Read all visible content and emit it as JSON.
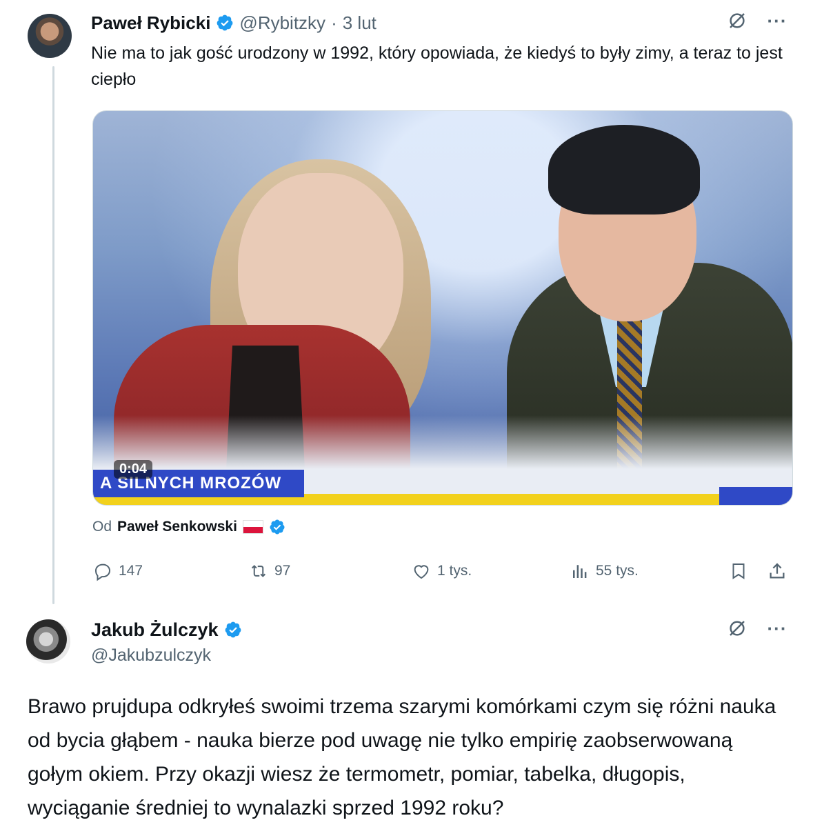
{
  "tweet1": {
    "author_name": "Paweł Rybicki",
    "handle": "@Rybitzky",
    "separator": "·",
    "date": "3 lut",
    "text": "Nie ma to jak gość urodzony w 1992, który opowiada, że kiedyś to były zimy, a teraz to jest ciepło",
    "media": {
      "timestamp": "0:04",
      "ticker_text": "A SILNYCH MROZÓW"
    },
    "attribution": {
      "label": "Od",
      "name": "Paweł Senkowski"
    },
    "actions": {
      "replies": "147",
      "reposts": "97",
      "likes": "1 tys.",
      "views": "55 tys."
    }
  },
  "tweet2": {
    "author_name": "Jakub Żulczyk",
    "handle": "@Jakubzulczyk",
    "text": "Brawo prujdupa odkryłeś swoimi trzema szarymi komórkami czym się różni nauka od bycia głąbem - nauka bierze pod uwagę nie tylko empirię zaobserwowaną gołym okiem. Przy okazji wiesz że termometr, pomiar, tabelka, długopis, wyciąganie średniej to wynalazki sprzed 1992 roku?"
  },
  "ui": {
    "more_label": "···"
  },
  "colors": {
    "verified_blue": "#1d9bf0",
    "secondary_text": "#536471",
    "ticker_blue": "#2f49c6",
    "ticker_yellow": "#f2d11c"
  }
}
